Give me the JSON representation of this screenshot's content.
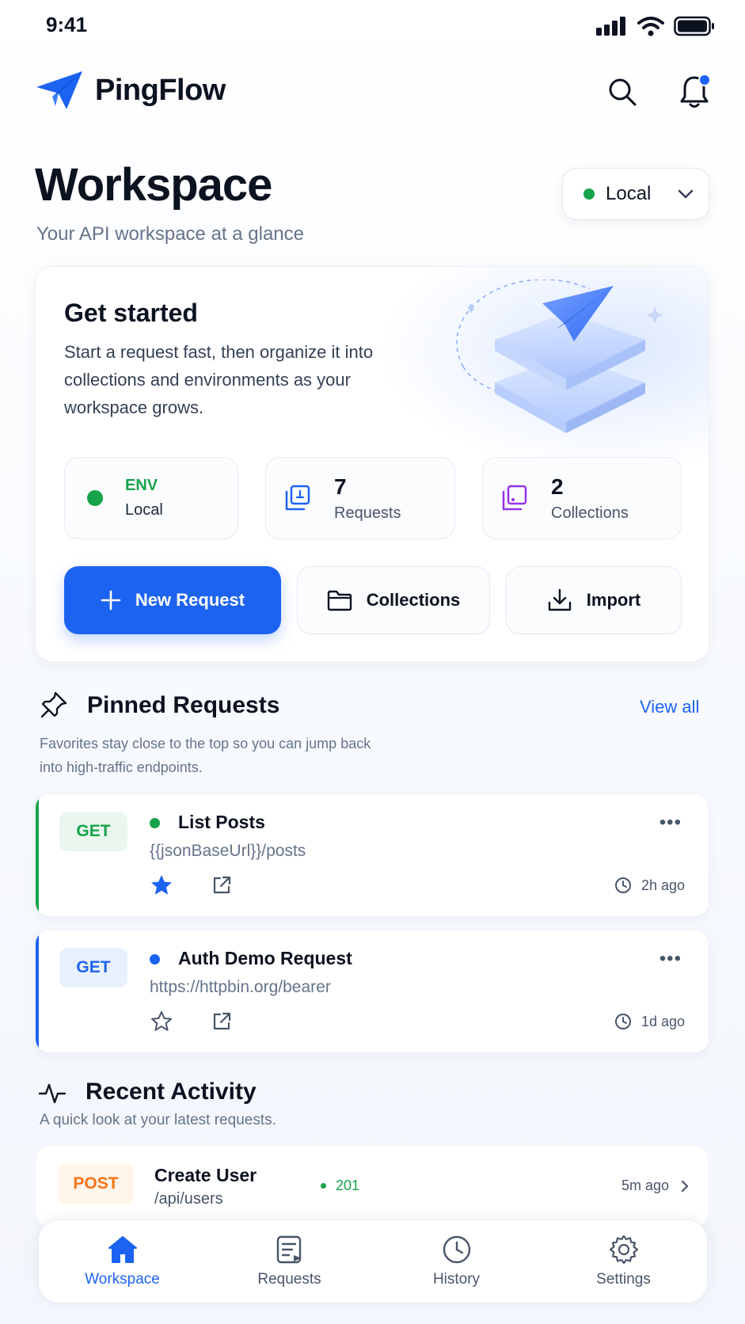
{
  "status": {
    "time": "9:41"
  },
  "app": {
    "name": "PingFlow"
  },
  "page": {
    "title": "Workspace",
    "subtitle": "Your API workspace at a glance"
  },
  "env_select": {
    "value": "Local",
    "status_color": "#16a34a"
  },
  "get_started": {
    "title": "Get started",
    "description": "Start a request fast, then organize it into collections and environments as your workspace grows.",
    "stats": {
      "env": {
        "label": "ENV",
        "value": "Local"
      },
      "requests": {
        "count": "7",
        "label": "Requests"
      },
      "collections": {
        "count": "2",
        "label": "Collections"
      }
    },
    "actions": {
      "new_request": "New Request",
      "collections": "Collections",
      "import": "Import"
    }
  },
  "pinned": {
    "title": "Pinned Requests",
    "view_all": "View all",
    "subtitle": "Favorites stay close to the top so you can jump back into high-traffic endpoints.",
    "items": [
      {
        "method": "GET",
        "name": "List Posts",
        "url": "{{jsonBaseUrl}}/posts",
        "time": "2h ago",
        "starred": true,
        "accent": "#16a34a"
      },
      {
        "method": "GET",
        "name": "Auth Demo Request",
        "url": "https://httpbin.org/bearer",
        "time": "1d ago",
        "starred": false,
        "accent": "#1d63f2"
      }
    ]
  },
  "recent": {
    "title": "Recent Activity",
    "subtitle": "A quick look at your latest requests.",
    "items": [
      {
        "method": "POST",
        "name": "Create User",
        "path": "/api/users",
        "status": "201",
        "time": "5m ago"
      }
    ]
  },
  "nav": {
    "workspace": "Workspace",
    "requests": "Requests",
    "history": "History",
    "settings": "Settings",
    "active": "workspace"
  },
  "colors": {
    "accent": "#1d63f2",
    "success": "#16a34a",
    "post": "#f97316"
  }
}
